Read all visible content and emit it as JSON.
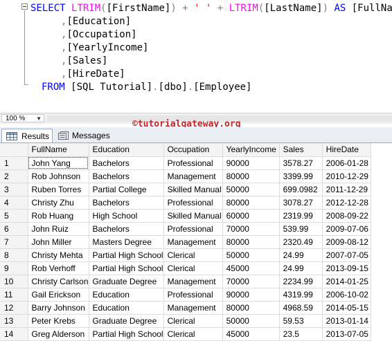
{
  "editor": {
    "lines": [
      [
        [
          "kw",
          "SELECT "
        ],
        [
          "fn",
          "LTRIM"
        ],
        [
          "op",
          "("
        ],
        [
          "plain",
          "[FirstName]"
        ],
        [
          "op",
          ")"
        ],
        [
          "plain",
          " "
        ],
        [
          "op",
          "+"
        ],
        [
          "plain",
          " "
        ],
        [
          "str",
          "' '"
        ],
        [
          "plain",
          " "
        ],
        [
          "op",
          "+"
        ],
        [
          "plain",
          " "
        ],
        [
          "fn",
          "LTRIM"
        ],
        [
          "op",
          "("
        ],
        [
          "plain",
          "[LastName]"
        ],
        [
          "op",
          ")"
        ],
        [
          "plain",
          " "
        ],
        [
          "kw",
          "AS"
        ],
        [
          "plain",
          " [FullName]"
        ]
      ],
      [
        [
          "op",
          ","
        ],
        [
          "plain",
          "[Education]"
        ]
      ],
      [
        [
          "op",
          ","
        ],
        [
          "plain",
          "[Occupation]"
        ]
      ],
      [
        [
          "op",
          ","
        ],
        [
          "plain",
          "[YearlyIncome]"
        ]
      ],
      [
        [
          "op",
          ","
        ],
        [
          "plain",
          "[Sales]"
        ]
      ],
      [
        [
          "op",
          ","
        ],
        [
          "plain",
          "[HireDate]"
        ]
      ],
      [
        [
          "kw",
          "FROM "
        ],
        [
          "plain",
          "[SQL Tutorial]"
        ],
        [
          "op",
          "."
        ],
        [
          "plain",
          "[dbo]"
        ],
        [
          "op",
          "."
        ],
        [
          "plain",
          "[Employee]"
        ]
      ]
    ]
  },
  "zoom": {
    "value": "100 %"
  },
  "watermark": "©tutorialgateway.org",
  "tabs": [
    {
      "label": "Results",
      "icon": "grid-icon",
      "active": true
    },
    {
      "label": "Messages",
      "icon": "messages-icon",
      "active": false
    }
  ],
  "grid": {
    "columns": [
      "FullName",
      "Education",
      "Occupation",
      "YearlyIncome",
      "Sales",
      "HireDate"
    ],
    "rows": [
      [
        "1",
        "John Yang",
        "Bachelors",
        "Professional",
        "90000",
        "3578.27",
        "2006-01-28"
      ],
      [
        "2",
        "Rob Johnson",
        "Bachelors",
        "Management",
        "80000",
        "3399.99",
        "2010-12-29"
      ],
      [
        "3",
        "Ruben Torres",
        "Partial College",
        "Skilled Manual",
        "50000",
        "699.0982",
        "2011-12-29"
      ],
      [
        "4",
        "Christy Zhu",
        "Bachelors",
        "Professional",
        "80000",
        "3078.27",
        "2012-12-28"
      ],
      [
        "5",
        "Rob Huang",
        "High School",
        "Skilled Manual",
        "60000",
        "2319.99",
        "2008-09-22"
      ],
      [
        "6",
        "John Ruiz",
        "Bachelors",
        "Professional",
        "70000",
        "539.99",
        "2009-07-06"
      ],
      [
        "7",
        "John Miller",
        "Masters Degree",
        "Management",
        "80000",
        "2320.49",
        "2009-08-12"
      ],
      [
        "8",
        "Christy Mehta",
        "Partial High School",
        "Clerical",
        "50000",
        "24.99",
        "2007-07-05"
      ],
      [
        "9",
        "Rob Verhoff",
        "Partial High School",
        "Clerical",
        "45000",
        "24.99",
        "2013-09-15"
      ],
      [
        "10",
        "Christy Carlson",
        "Graduate Degree",
        "Management",
        "70000",
        "2234.99",
        "2014-01-25"
      ],
      [
        "11",
        "Gail Erickson",
        "Education",
        "Professional",
        "90000",
        "4319.99",
        "2006-10-02"
      ],
      [
        "12",
        "Barry Johnson",
        "Education",
        "Management",
        "80000",
        "4968.59",
        "2014-05-15"
      ],
      [
        "13",
        "Peter Krebs",
        "Graduate Degree",
        "Clerical",
        "50000",
        "59.53",
        "2013-01-14"
      ],
      [
        "14",
        "Greg Alderson",
        "Partial High School",
        "Clerical",
        "45000",
        "23.5",
        "2013-07-05"
      ]
    ]
  }
}
